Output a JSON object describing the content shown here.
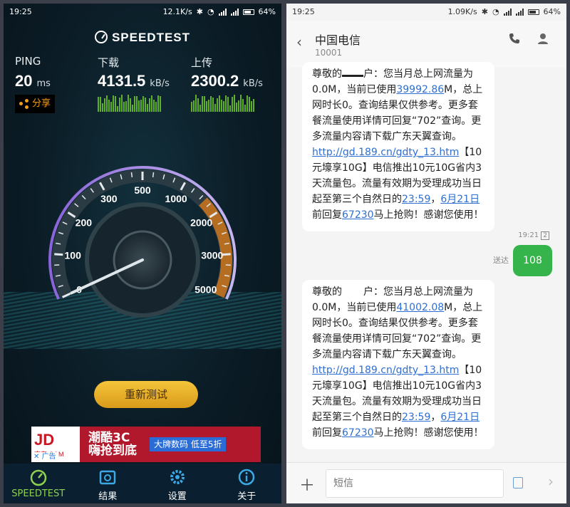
{
  "left": {
    "status": {
      "time": "19:25",
      "speed": "12.1K/s",
      "battery": "64%"
    },
    "app_title": "SPEEDTEST",
    "ping": {
      "label": "PING",
      "value": "20",
      "unit": "ms"
    },
    "download": {
      "label": "下载",
      "value": "4131.5",
      "unit": "kB/s"
    },
    "upload": {
      "label": "上传",
      "value": "2300.2",
      "unit": "kB/s"
    },
    "share_label": "分享",
    "gauge": {
      "ticks": [
        "0",
        "100",
        "200",
        "300",
        "500",
        "1000",
        "2000",
        "3000",
        "5000"
      ],
      "needle_value": "0"
    },
    "retest_label": "重新测试",
    "ad": {
      "jd": "JD",
      "jd_sub": "京东",
      "jd_domain": ".COM",
      "slogan": "潮酷3C 嗨抢到底",
      "brand": "大牌数码 低至5折",
      "ad_tag": "广告"
    },
    "tabs": [
      {
        "label": "SPEEDTEST",
        "icon": "speedometer-icon",
        "active": true
      },
      {
        "label": "结果",
        "icon": "results-icon",
        "active": false
      },
      {
        "label": "设置",
        "icon": "gear-icon",
        "active": false
      },
      {
        "label": "关于",
        "icon": "info-icon",
        "active": false
      }
    ]
  },
  "right": {
    "status": {
      "time": "19:25",
      "speed": "1.09K/s",
      "battery": "64%"
    },
    "contact_name": "中国电信",
    "contact_number": "10001",
    "messages": [
      {
        "p1": "尊敬的",
        "p2": "户：您当月总上网流量为0.0M，当前已使用",
        "used": "39992.86",
        "p3": "M，总上网时长0。查询结果仅供参考。更多套餐流量使用详情可回复“702”查询。更多流量内容请下载广东天翼查询。",
        "link": "http://gd.189.cn/gdty_13.htm",
        "p4": "【10元壕享10G】电信推出10元10G省内3天流量包。流量有效期为受理成功当日起至第三个自然日的",
        "t1": "23:59",
        "p5": "，",
        "t2": "6月21日",
        "p6": "前回复",
        "code": "67230",
        "p7": "马上抢购！感谢您使用！"
      },
      {
        "p1": "尊敬的",
        "p2": "户：您当月总上网流量为0.0M，当前已使用",
        "used": "41002.08",
        "p3": "M，总上网时长0。查询结果仅供参考。更多套餐流量使用详情可回复“702”查询。更多流量内容请下载广东天翼查询。",
        "link": "http://gd.189.cn/gdty_13.htm",
        "p4": "【10元壕享10G】电信推出10元10G省内3天流量包。流量有效期为受理成功当日起至第三个自然日的",
        "t1": "23:59",
        "p5": "，",
        "t2": "6月21日",
        "p6": "前回复",
        "code": "67230",
        "p7": "马上抢购！感谢您使用！"
      }
    ],
    "sent": {
      "time": "19:21",
      "sim": "2",
      "label": "送达",
      "text": "108"
    },
    "input_placeholder": "短信",
    "accent_green": "#34b44a",
    "link_color": "#2e6fd1"
  }
}
